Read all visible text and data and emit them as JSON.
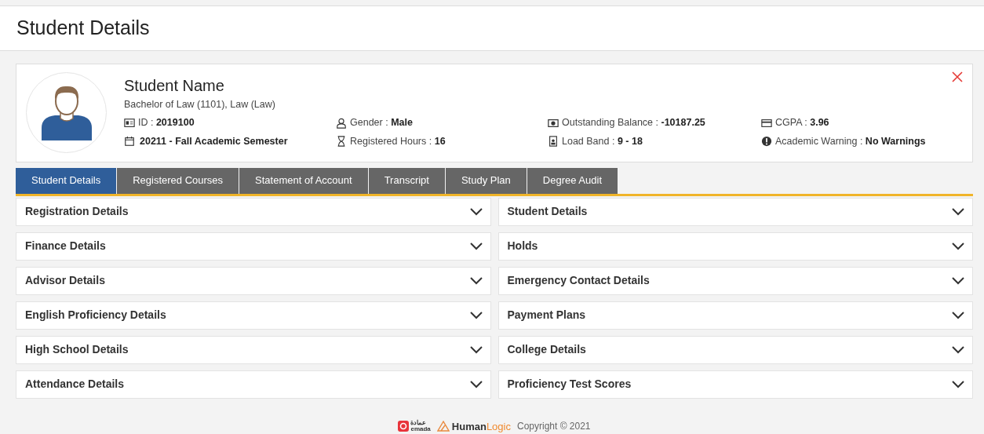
{
  "page_title": "Student Details",
  "profile": {
    "name": "Student Name",
    "program": "Bachelor of Law (1101), Law (Law)",
    "fields": [
      {
        "kind": "id",
        "label": "ID : ",
        "value": "2019100"
      },
      {
        "kind": "user",
        "label": "Gender : ",
        "value": "Male"
      },
      {
        "kind": "money",
        "label": "Outstanding Balance : ",
        "value": "-10187.25"
      },
      {
        "kind": "card",
        "label": "CGPA : ",
        "value": "3.96"
      },
      {
        "kind": "calendar",
        "value": "20211 - Fall Academic Semester"
      },
      {
        "kind": "hourglass",
        "label": "Registered Hours : ",
        "value": "16"
      },
      {
        "kind": "badge",
        "label": "Load Band : ",
        "value": "9 - 18"
      },
      {
        "kind": "alert",
        "label": "Academic Warning : ",
        "value": "No Warnings"
      }
    ]
  },
  "tabs": [
    {
      "label": "Student Details",
      "selected": true
    },
    {
      "label": "Registered Courses",
      "selected": false
    },
    {
      "label": "Statement of Account",
      "selected": false
    },
    {
      "label": "Transcript",
      "selected": false
    },
    {
      "label": "Study Plan",
      "selected": false
    },
    {
      "label": "Degree Audit",
      "selected": false
    }
  ],
  "sections": [
    {
      "label": "Registration Details",
      "expanded": false
    },
    {
      "label": "Student Details",
      "expanded": false
    },
    {
      "label": "Finance Details",
      "expanded": false
    },
    {
      "label": "Holds",
      "expanded": false
    },
    {
      "label": "Advisor Details",
      "expanded": false
    },
    {
      "label": "Emergency Contact Details",
      "expanded": false
    },
    {
      "label": "English Proficiency Details",
      "expanded": false
    },
    {
      "label": "Payment Plans",
      "expanded": false
    },
    {
      "label": "High School Details",
      "expanded": false
    },
    {
      "label": "College Details",
      "expanded": false
    },
    {
      "label": "Attendance Details",
      "expanded": false
    },
    {
      "label": "Proficiency Test Scores",
      "expanded": false
    }
  ],
  "footer": {
    "emada_arabic": "عمادة",
    "emada_latin": "emada",
    "brand_first": "Human",
    "brand_second": "Logic",
    "copyright": "Copyright © 2021"
  }
}
